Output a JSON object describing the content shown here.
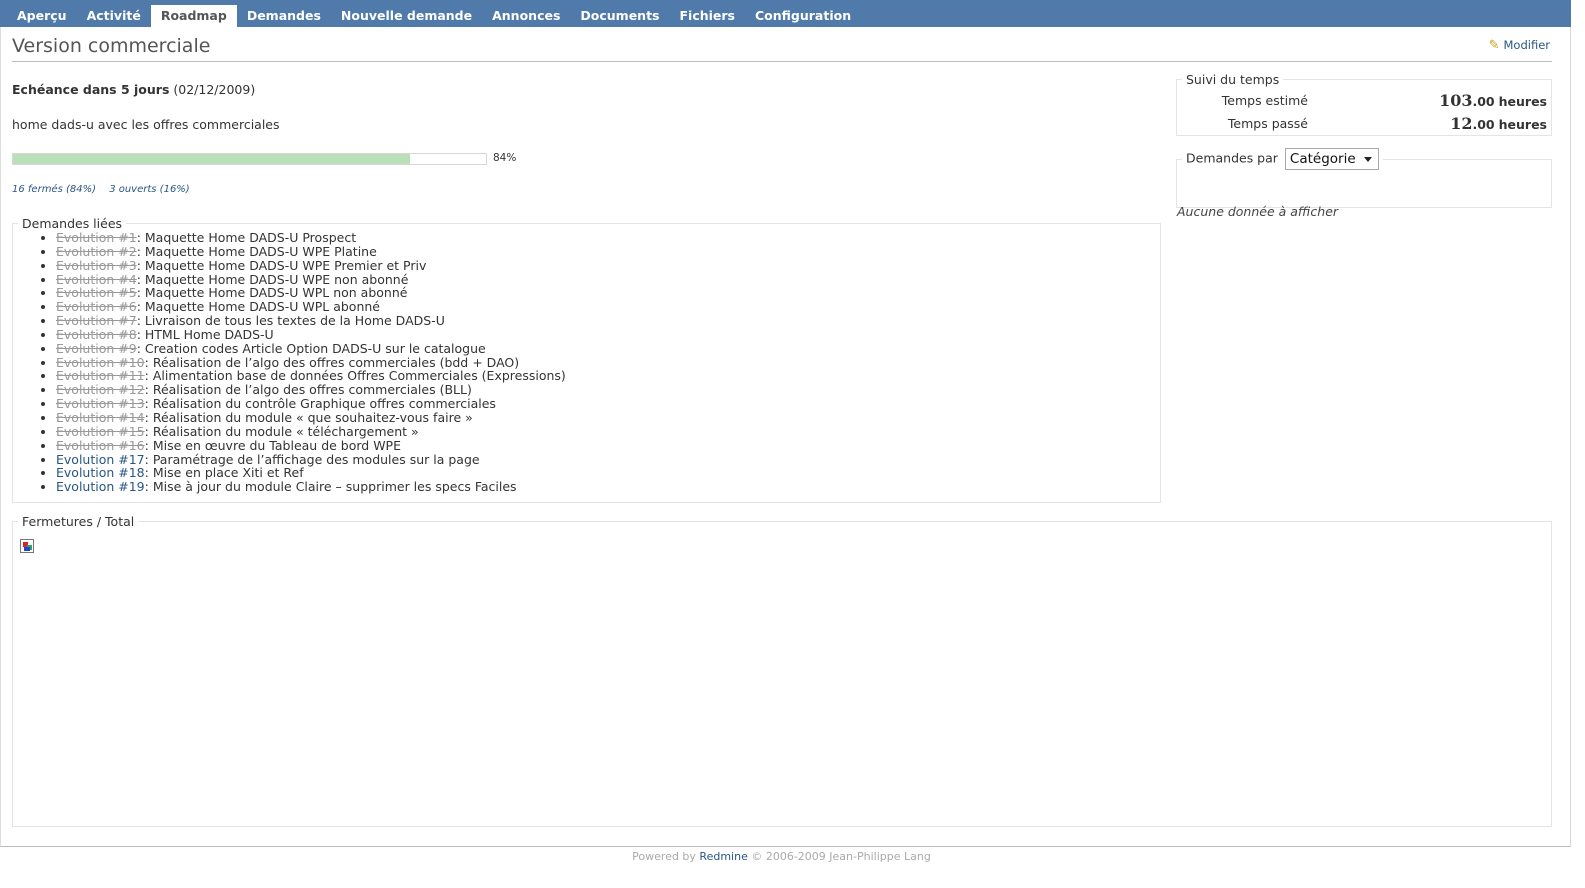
{
  "menu": {
    "items": [
      "Aperçu",
      "Activité",
      "Roadmap",
      "Demandes",
      "Nouvelle demande",
      "Annonces",
      "Documents",
      "Fichiers",
      "Configuration"
    ],
    "selected_index": 2
  },
  "header": {
    "title": "Version commerciale",
    "modify_label": "Modifier"
  },
  "version": {
    "due_label": "Echéance dans 5 jours",
    "due_date": "(02/12/2009)",
    "description": "home dads-u avec les offres commerciales",
    "progress_percent": 84,
    "progress_label": "84%",
    "closed_link": "16 fermés (84%)",
    "open_link": "3 ouverts (16%)"
  },
  "related": {
    "legend": "Demandes liées",
    "issues": [
      {
        "ref": "Evolution #1",
        "subject": ": Maquette Home DADS-U Prospect",
        "closed": true
      },
      {
        "ref": "Evolution #2",
        "subject": ": Maquette Home DADS-U WPE Platine",
        "closed": true
      },
      {
        "ref": "Evolution #3",
        "subject": ": Maquette Home DADS-U WPE Premier et Priv",
        "closed": true
      },
      {
        "ref": "Evolution #4",
        "subject": ": Maquette Home DADS-U WPE non abonné",
        "closed": true
      },
      {
        "ref": "Evolution #5",
        "subject": ": Maquette Home DADS-U WPL non abonné",
        "closed": true
      },
      {
        "ref": "Evolution #6",
        "subject": ": Maquette Home DADS-U WPL abonné",
        "closed": true
      },
      {
        "ref": "Evolution #7",
        "subject": ": Livraison de tous les textes de la Home DADS-U",
        "closed": true
      },
      {
        "ref": "Evolution #8",
        "subject": ": HTML Home DADS-U",
        "closed": true
      },
      {
        "ref": "Evolution #9",
        "subject": ": Creation codes Article Option DADS-U sur le catalogue",
        "closed": true
      },
      {
        "ref": "Evolution #10",
        "subject": ": Réalisation de l’algo des offres commerciales (bdd + DAO)",
        "closed": true
      },
      {
        "ref": "Evolution #11",
        "subject": ": Alimentation base de données Offres Commerciales (Expressions)",
        "closed": true
      },
      {
        "ref": "Evolution #12",
        "subject": ": Réalisation de l’algo des offres commerciales (BLL)",
        "closed": true
      },
      {
        "ref": "Evolution #13",
        "subject": ": Réalisation du contrôle Graphique offres commerciales",
        "closed": true
      },
      {
        "ref": "Evolution #14",
        "subject": ": Réalisation du module « que souhaitez-vous faire »",
        "closed": true
      },
      {
        "ref": "Evolution #15",
        "subject": ": Réalisation du module « téléchargement »",
        "closed": true
      },
      {
        "ref": "Evolution #16",
        "subject": ": Mise en œuvre du Tableau de bord WPE",
        "closed": true
      },
      {
        "ref": "Evolution #17",
        "subject": ": Paramétrage de l’affichage des modules sur la page",
        "closed": false
      },
      {
        "ref": "Evolution #18",
        "subject": ": Mise en place Xiti et Ref",
        "closed": false
      },
      {
        "ref": "Evolution #19",
        "subject": ": Mise à jour du module Claire – supprimer les specs Faciles",
        "closed": false
      }
    ]
  },
  "time_tracking": {
    "legend": "Suivi du temps",
    "estimated_label": "Temps estimé",
    "estimated_int": "103",
    "estimated_dec": ".00",
    "spent_label": "Temps passé",
    "spent_int": "12",
    "spent_dec": ".00",
    "unit": "heures"
  },
  "issues_by": {
    "legend_label": "Demandes par",
    "selected": "Catégorie",
    "empty": "Aucune donnée à afficher"
  },
  "chart": {
    "legend": "Fermetures / Total"
  },
  "footer": {
    "prefix": "Powered by",
    "link": "Redmine",
    "suffix": "© 2006-2009 Jean-Philippe Lang"
  }
}
